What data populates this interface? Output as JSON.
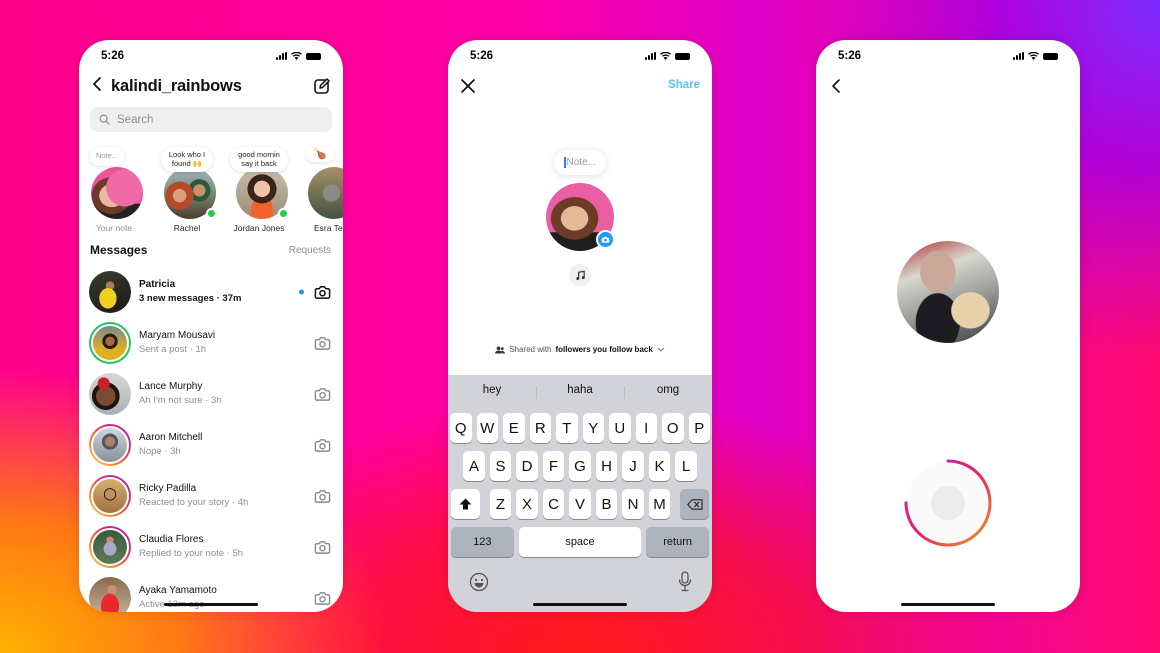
{
  "status_bar": {
    "time": "5:26"
  },
  "inbox": {
    "username": "kalindi_rainbows",
    "search_placeholder": "Search",
    "notes": [
      {
        "name": "Your note",
        "bubble": "Note...",
        "is_placeholder": true,
        "online": false
      },
      {
        "name": "Rachel",
        "bubble": "Look who I\nfound 🙌",
        "online": true
      },
      {
        "name": "Jordan Jones",
        "bubble": "good mornin\nsay it back",
        "online": true
      },
      {
        "name": "Esra Tek",
        "bubble": "🍗",
        "online": false
      }
    ],
    "messages_title": "Messages",
    "requests_label": "Requests",
    "threads": [
      {
        "name": "Patricia",
        "preview": "3 new messages · 37m",
        "unread": true,
        "ring": "none"
      },
      {
        "name": "Maryam Mousavi",
        "preview": "Sent a post · 1h",
        "unread": false,
        "ring": "green"
      },
      {
        "name": "Lance Murphy",
        "preview": "Ah I'm not sure · 3h",
        "unread": false,
        "ring": "none"
      },
      {
        "name": "Aaron Mitchell",
        "preview": "Nope · 3h",
        "unread": false,
        "ring": "story"
      },
      {
        "name": "Ricky Padilla",
        "preview": "Reacted to your story · 4h",
        "unread": false,
        "ring": "story"
      },
      {
        "name": "Claudia Flores",
        "preview": "Replied to your note · 5h",
        "unread": false,
        "ring": "story"
      },
      {
        "name": "Ayaka Yamamoto",
        "preview": "Active 13m ago",
        "unread": false,
        "ring": "none"
      }
    ]
  },
  "compose_note": {
    "share_label": "Share",
    "note_placeholder": "Note...",
    "shared_with_prefix": "Shared with",
    "shared_with_audience": "followers you follow back",
    "suggestions": [
      "hey",
      "haha",
      "omg"
    ],
    "keyboard_rows": [
      [
        "Q",
        "W",
        "E",
        "R",
        "T",
        "Y",
        "U",
        "I",
        "O",
        "P"
      ],
      [
        "A",
        "S",
        "D",
        "F",
        "G",
        "H",
        "J",
        "K",
        "L"
      ],
      [
        "Z",
        "X",
        "C",
        "V",
        "B",
        "N",
        "M"
      ]
    ],
    "numbers_key": "123",
    "space_key": "space",
    "return_key": "return"
  },
  "camera": {
    "record_progress": 0.75
  },
  "colors": {
    "accent_blue": "#1d9bf0",
    "share_blue": "#58c3f0",
    "online_green": "#2ac94a"
  }
}
